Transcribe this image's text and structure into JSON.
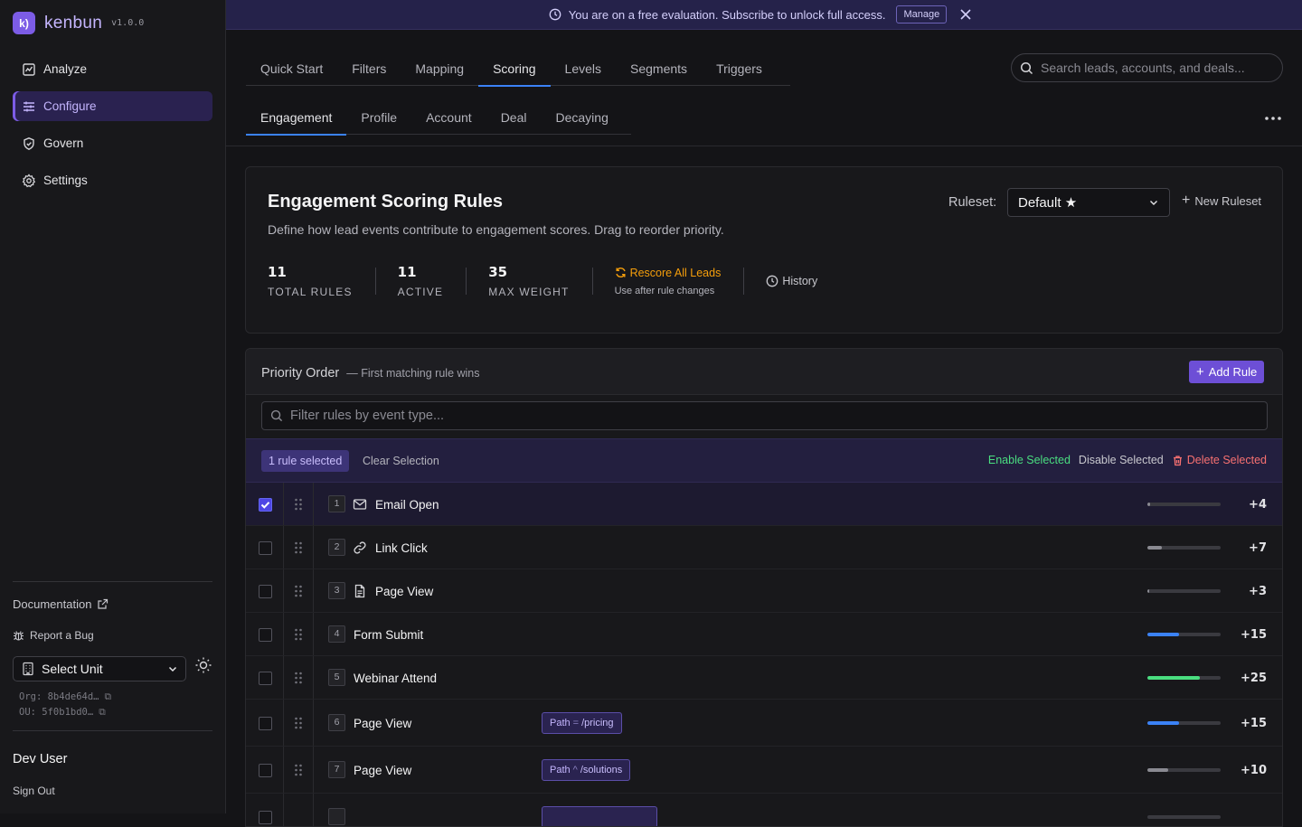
{
  "app": {
    "name": "kenbun",
    "version": "v1.0.0",
    "logo_glyph": "k)"
  },
  "colors": {
    "accent": "#7c5ce6",
    "tab_active": "#3b82f6",
    "rescore": "#f59e0b",
    "enable": "#4ade80",
    "delete": "#f87171"
  },
  "sidebar": {
    "items": [
      {
        "label": "Analyze",
        "icon": "analyze-icon"
      },
      {
        "label": "Configure",
        "icon": "sliders-icon",
        "active": true
      },
      {
        "label": "Govern",
        "icon": "shield-icon"
      },
      {
        "label": "Settings",
        "icon": "gear-icon"
      }
    ],
    "documentation": "Documentation",
    "report_bug": "Report a Bug",
    "unit_select": "Select Unit",
    "org_id": "Org: 8b4de64d…",
    "ou_id": "OU: 5f0b1bd0…",
    "user_name": "Dev User",
    "sign_out": "Sign Out"
  },
  "banner": {
    "text": "You are on a free evaluation. Subscribe to unlock full access.",
    "manage": "Manage"
  },
  "tabs_primary": [
    "Quick Start",
    "Filters",
    "Mapping",
    "Scoring",
    "Levels",
    "Segments",
    "Triggers"
  ],
  "tabs_primary_active": "Scoring",
  "tabs_secondary": [
    "Engagement",
    "Profile",
    "Account",
    "Deal",
    "Decaying"
  ],
  "tabs_secondary_active": "Engagement",
  "search": {
    "placeholder": "Search leads, accounts, and deals..."
  },
  "header_card": {
    "title": "Engagement Scoring Rules",
    "description": "Define how lead events contribute to engagement scores. Drag to reorder priority.",
    "ruleset_label": "Ruleset:",
    "ruleset_value": "Default ★",
    "new_ruleset": "New Ruleset",
    "stats": [
      {
        "value": "11",
        "label": "TOTAL RULES"
      },
      {
        "value": "11",
        "label": "ACTIVE"
      },
      {
        "value": "35",
        "label": "MAX WEIGHT"
      }
    ],
    "rescore_title": "Rescore All Leads",
    "rescore_sub": "Use after rule changes",
    "history": "History"
  },
  "rules_card": {
    "title": "Priority Order",
    "subtitle": "— First matching rule wins",
    "add_rule": "Add Rule",
    "filter_placeholder": "Filter rules by event type...",
    "selection": {
      "count": "1 rule selected",
      "clear": "Clear Selection",
      "enable": "Enable Selected",
      "disable": "Disable Selected",
      "delete": "Delete Selected"
    },
    "rules": [
      {
        "priority": "1",
        "name": "Email Open",
        "icon": "mail-icon",
        "weight": "+4",
        "level": 0.04,
        "bar_color": "#8a8a92",
        "selected": true
      },
      {
        "priority": "2",
        "name": "Link Click",
        "icon": "link-icon",
        "weight": "+7",
        "level": 0.2,
        "bar_color": "#8a8a92"
      },
      {
        "priority": "3",
        "name": "Page View",
        "icon": "file-icon",
        "weight": "+3",
        "level": 0.03,
        "bar_color": "#8a8a92"
      },
      {
        "priority": "4",
        "name": "Form Submit",
        "weight": "+15",
        "level": 0.43,
        "bar_color": "#3b82f6"
      },
      {
        "priority": "5",
        "name": "Webinar Attend",
        "weight": "+25",
        "level": 0.71,
        "bar_color": "#4ade80"
      },
      {
        "priority": "6",
        "name": "Page View",
        "cond_key": "Path",
        "cond_op": "=",
        "cond_val": "/pricing",
        "weight": "+15",
        "level": 0.43,
        "bar_color": "#3b82f6"
      },
      {
        "priority": "7",
        "name": "Page View",
        "cond_key": "Path",
        "cond_op": "^",
        "cond_val": "/solutions",
        "weight": "+10",
        "level": 0.29,
        "bar_color": "#8a8a92"
      }
    ]
  }
}
